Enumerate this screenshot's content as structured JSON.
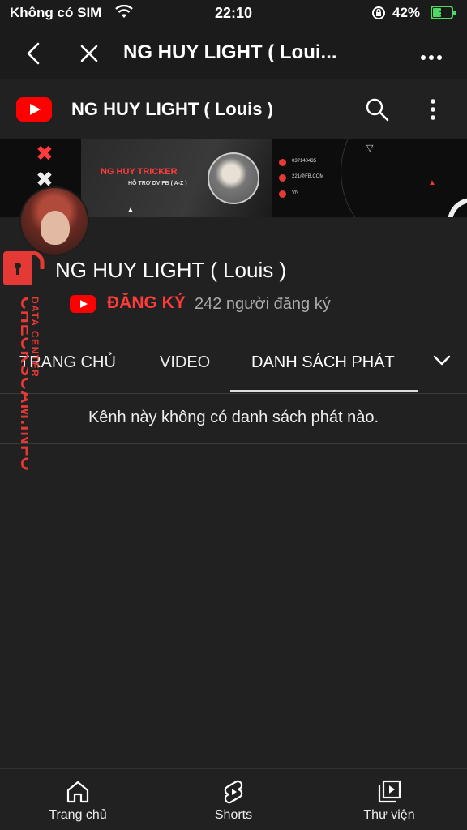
{
  "status_bar": {
    "carrier": "Không có SIM",
    "time": "22:10",
    "battery": "42%"
  },
  "browser": {
    "title": "NG HUY LIGHT ( Loui..."
  },
  "yt_header": {
    "channel_name": "NG HUY LIGHT ( Louis )"
  },
  "banner": {
    "name": "NG HUY TRICKER",
    "subtitle": "HỖ TRỢ DV FB ( A-Z )",
    "phone": "037140435",
    "email": "221@FB.COM",
    "location": "VN"
  },
  "channel": {
    "title": "NG HUY LIGHT ( Louis )",
    "subscribe_label": "ĐĂNG KÝ",
    "subscriber_count": "242 người đăng ký"
  },
  "tabs": [
    {
      "label": "TRANG CHỦ"
    },
    {
      "label": "VIDEO"
    },
    {
      "label": "DANH SÁCH PHÁT",
      "active": true
    }
  ],
  "empty_message": "Kênh này không có danh sách phát nào.",
  "watermark": {
    "main": "CHECKSCAM.INFO",
    "secondary": "DATA CENTER"
  },
  "bottom_nav": [
    {
      "label": "Trang chủ",
      "icon": "home-icon"
    },
    {
      "label": "Shorts",
      "icon": "shorts-icon"
    },
    {
      "label": "Thư viện",
      "icon": "library-icon"
    }
  ],
  "colors": {
    "accent": "#ff0000",
    "subscribe": "#ff3b3b",
    "background": "#212121"
  }
}
